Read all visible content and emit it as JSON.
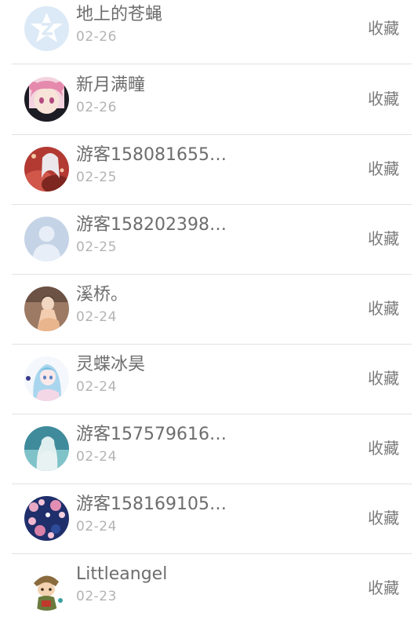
{
  "rows": [
    {
      "name": "地上的苍蝇",
      "date": "02-26",
      "action": "收藏",
      "avatar_icon": "qzone-star-avatar-icon",
      "avatar_color": "#dce9f6"
    },
    {
      "name": "新月满疃",
      "date": "02-26",
      "action": "收藏",
      "avatar_icon": "anime-girl-pink-avatar-icon",
      "avatar_color": "#f0b6c8"
    },
    {
      "name": "游客158081655…",
      "date": "02-25",
      "action": "收藏",
      "avatar_icon": "anime-girl-red-avatar-icon",
      "avatar_color": "#b23a33"
    },
    {
      "name": "游客158202398…",
      "date": "02-25",
      "action": "收藏",
      "avatar_icon": "default-user-avatar-icon",
      "avatar_color": "#c5d3e6"
    },
    {
      "name": "溪桥。",
      "date": "02-24",
      "action": "收藏",
      "avatar_icon": "doll-avatar-icon",
      "avatar_color": "#b89578"
    },
    {
      "name": "灵蝶冰昊",
      "date": "02-24",
      "action": "收藏",
      "avatar_icon": "anime-girl-blue-hair-avatar-icon",
      "avatar_color": "#bfe0f0"
    },
    {
      "name": "游客157579616…",
      "date": "02-24",
      "action": "收藏",
      "avatar_icon": "anime-girl-teal-avatar-icon",
      "avatar_color": "#5fa8b8"
    },
    {
      "name": "游客158169105…",
      "date": "02-24",
      "action": "收藏",
      "avatar_icon": "blossom-night-avatar-icon",
      "avatar_color": "#1f2f6b"
    },
    {
      "name": "Littleangel",
      "date": "02-23",
      "action": "收藏",
      "avatar_icon": "cartoon-character-avatar-icon",
      "avatar_color": "#8a6b3e"
    }
  ]
}
